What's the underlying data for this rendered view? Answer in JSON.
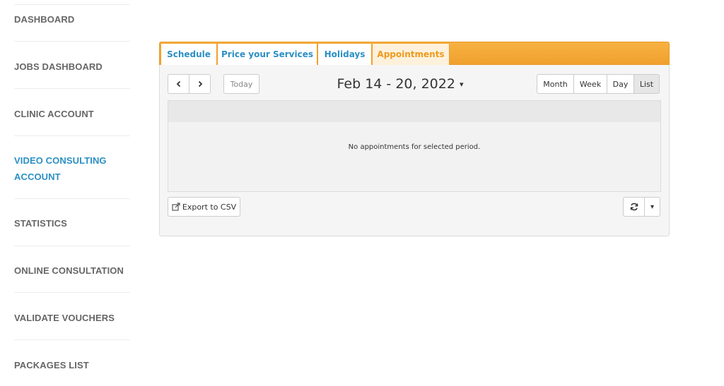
{
  "sidebar": {
    "items": [
      {
        "label": "DASHBOARD"
      },
      {
        "label": "JOBS DASHBOARD"
      },
      {
        "label": "CLINIC ACCOUNT"
      },
      {
        "label": "VIDEO CONSULTING ACCOUNT",
        "line1": "VIDEO CONSULTING",
        "line2": "ACCOUNT",
        "active": true
      },
      {
        "label": "STATISTICS"
      },
      {
        "label": "ONLINE CONSULTATION"
      },
      {
        "label": "VALIDATE VOUCHERS"
      },
      {
        "label": "PACKAGES LIST"
      }
    ]
  },
  "tabs": [
    {
      "label": "Schedule"
    },
    {
      "label": "Price your Services"
    },
    {
      "label": "Holidays"
    },
    {
      "label": "Appointments",
      "active": true
    }
  ],
  "toolbar": {
    "prev_icon": "chevron-left-icon",
    "next_icon": "chevron-right-icon",
    "today_label": "Today",
    "period_title": "Feb 14 - 20, 2022",
    "views": [
      {
        "label": "Month"
      },
      {
        "label": "Week"
      },
      {
        "label": "Day"
      },
      {
        "label": "List",
        "active": true
      }
    ]
  },
  "list": {
    "empty_message": "No appointments for selected period."
  },
  "footer": {
    "export_label": "Export to CSV",
    "export_icon": "external-link-icon",
    "refresh_icon": "refresh-icon",
    "menu_icon": "caret-down-icon"
  },
  "colors": {
    "accent_orange": "#f0a02e",
    "link_blue": "#2b8fc4",
    "active_tab_text": "#ef9a1c"
  }
}
